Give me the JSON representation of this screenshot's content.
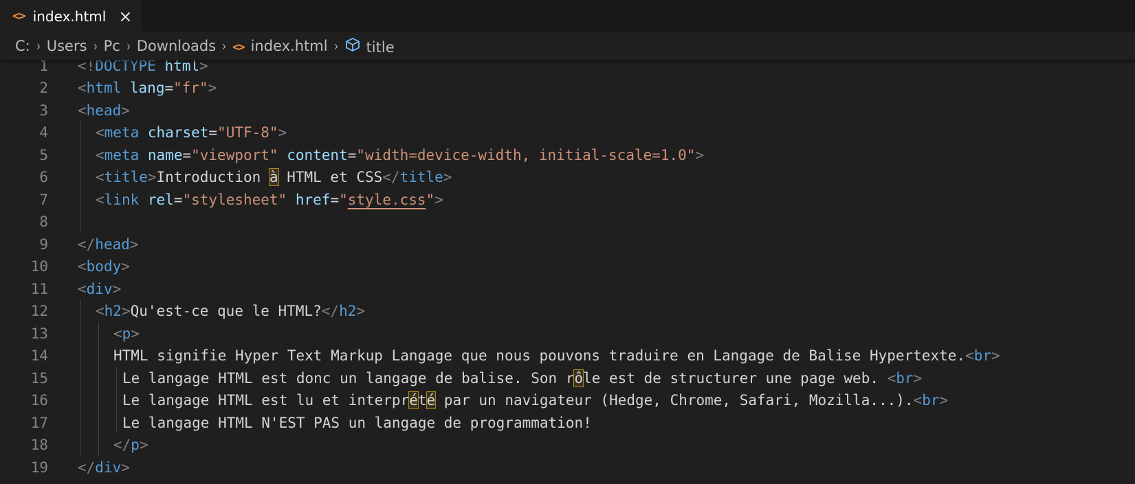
{
  "tab": {
    "icon": "<>",
    "title": "index.html",
    "close": "×"
  },
  "breadcrumb": {
    "items": [
      "C:",
      "Users",
      "Pc",
      "Downloads",
      "index.html",
      "title"
    ],
    "separator": "›",
    "file_icon": "<>"
  },
  "colors": {
    "tag": "#569cd6",
    "attribute": "#9cdcfe",
    "string": "#ce9178",
    "text": "#d4d4d4",
    "file_icon": "#e8893a",
    "symbol_icon": "#75beff"
  },
  "editor": {
    "lines": [
      {
        "num": "1",
        "indent": 0,
        "tokens": [
          [
            "b",
            "<!"
          ],
          [
            "t",
            "DOCTYPE"
          ],
          [
            "x",
            " "
          ],
          [
            "a",
            "html"
          ],
          [
            "b",
            ">"
          ]
        ]
      },
      {
        "num": "2",
        "indent": 0,
        "tokens": [
          [
            "b",
            "<"
          ],
          [
            "t",
            "html"
          ],
          [
            "x",
            " "
          ],
          [
            "a",
            "lang"
          ],
          [
            "x",
            "="
          ],
          [
            "s",
            "\"fr\""
          ],
          [
            "b",
            ">"
          ]
        ]
      },
      {
        "num": "3",
        "indent": 0,
        "tokens": [
          [
            "b",
            "<"
          ],
          [
            "t",
            "head"
          ],
          [
            "b",
            ">"
          ]
        ]
      },
      {
        "num": "4",
        "indent": 1,
        "tokens": [
          [
            "b",
            "<"
          ],
          [
            "t",
            "meta"
          ],
          [
            "x",
            " "
          ],
          [
            "a",
            "charset"
          ],
          [
            "x",
            "="
          ],
          [
            "s",
            "\"UTF-8\""
          ],
          [
            "b",
            ">"
          ]
        ]
      },
      {
        "num": "5",
        "indent": 1,
        "tokens": [
          [
            "b",
            "<"
          ],
          [
            "t",
            "meta"
          ],
          [
            "x",
            " "
          ],
          [
            "a",
            "name"
          ],
          [
            "x",
            "="
          ],
          [
            "s",
            "\"viewport\""
          ],
          [
            "x",
            " "
          ],
          [
            "a",
            "content"
          ],
          [
            "x",
            "="
          ],
          [
            "s",
            "\"width=device-width, initial-scale=1.0\""
          ],
          [
            "b",
            ">"
          ]
        ]
      },
      {
        "num": "6",
        "indent": 1,
        "tokens": [
          [
            "b",
            "<"
          ],
          [
            "t",
            "title"
          ],
          [
            "b",
            ">"
          ],
          [
            "x",
            "Introduction "
          ],
          [
            "xh",
            "à"
          ],
          [
            "x",
            " HTML et CSS"
          ],
          [
            "b",
            "</"
          ],
          [
            "t",
            "title"
          ],
          [
            "b",
            ">"
          ]
        ]
      },
      {
        "num": "7",
        "indent": 1,
        "tokens": [
          [
            "b",
            "<"
          ],
          [
            "t",
            "link"
          ],
          [
            "x",
            " "
          ],
          [
            "a",
            "rel"
          ],
          [
            "x",
            "="
          ],
          [
            "s",
            "\"stylesheet\""
          ],
          [
            "x",
            " "
          ],
          [
            "a",
            "href"
          ],
          [
            "x",
            "="
          ],
          [
            "s",
            "\""
          ],
          [
            "su",
            "style.css"
          ],
          [
            "s",
            "\""
          ],
          [
            "b",
            ">"
          ]
        ]
      },
      {
        "num": "8",
        "indent": 1,
        "tokens": []
      },
      {
        "num": "9",
        "indent": 0,
        "tokens": [
          [
            "b",
            "</"
          ],
          [
            "t",
            "head"
          ],
          [
            "b",
            ">"
          ]
        ]
      },
      {
        "num": "10",
        "indent": 0,
        "tokens": [
          [
            "b",
            "<"
          ],
          [
            "t",
            "body"
          ],
          [
            "b",
            ">"
          ]
        ]
      },
      {
        "num": "11",
        "indent": 0,
        "tokens": [
          [
            "b",
            "<"
          ],
          [
            "t",
            "div"
          ],
          [
            "b",
            ">"
          ]
        ]
      },
      {
        "num": "12",
        "indent": 1,
        "tokens": [
          [
            "b",
            "<"
          ],
          [
            "t",
            "h2"
          ],
          [
            "b",
            ">"
          ],
          [
            "x",
            "Qu'est-ce que le HTML?"
          ],
          [
            "b",
            "</"
          ],
          [
            "t",
            "h2"
          ],
          [
            "b",
            ">"
          ]
        ]
      },
      {
        "num": "13",
        "indent": 2,
        "tokens": [
          [
            "b",
            "<"
          ],
          [
            "t",
            "p"
          ],
          [
            "b",
            ">"
          ]
        ]
      },
      {
        "num": "14",
        "indent": 2,
        "tokens": [
          [
            "x",
            "HTML signifie Hyper Text Markup Langage que nous pouvons traduire en Langage de Balise Hypertexte."
          ],
          [
            "b",
            "<"
          ],
          [
            "t",
            "br"
          ],
          [
            "b",
            ">"
          ]
        ]
      },
      {
        "num": "15",
        "indent": 2.5,
        "tokens": [
          [
            "x",
            "Le langage HTML est donc un langage de balise. Son r"
          ],
          [
            "xh",
            "ô"
          ],
          [
            "x",
            "le est de structurer une page web. "
          ],
          [
            "b",
            "<"
          ],
          [
            "t",
            "br"
          ],
          [
            "b",
            ">"
          ]
        ]
      },
      {
        "num": "16",
        "indent": 2.5,
        "tokens": [
          [
            "x",
            "Le langage HTML est lu et interpr"
          ],
          [
            "xh",
            "é"
          ],
          [
            "x",
            "t"
          ],
          [
            "xh",
            "é"
          ],
          [
            "x",
            " par un navigateur (Hedge, Chrome, Safari, Mozilla...)."
          ],
          [
            "b",
            "<"
          ],
          [
            "t",
            "br"
          ],
          [
            "b",
            ">"
          ]
        ]
      },
      {
        "num": "17",
        "indent": 2.5,
        "tokens": [
          [
            "x",
            "Le langage HTML N'EST PAS un langage de programmation!"
          ]
        ]
      },
      {
        "num": "18",
        "indent": 2,
        "tokens": [
          [
            "b",
            "</"
          ],
          [
            "t",
            "p"
          ],
          [
            "b",
            ">"
          ]
        ]
      },
      {
        "num": "19",
        "indent": 0,
        "tokens": [
          [
            "b",
            "</"
          ],
          [
            "t",
            "div"
          ],
          [
            "b",
            ">"
          ]
        ]
      }
    ]
  }
}
